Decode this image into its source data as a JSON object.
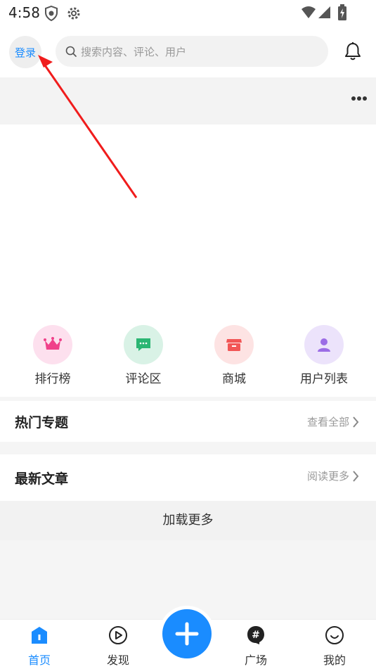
{
  "status_bar": {
    "time": "4:58"
  },
  "header": {
    "login_label": "登录",
    "search_placeholder": "搜索内容、评论、用户"
  },
  "quick_nav": [
    {
      "label": "排行榜",
      "icon": "crown-icon",
      "bg": "#fde0ee",
      "color": "#f0418a"
    },
    {
      "label": "评论区",
      "icon": "comment-icon",
      "bg": "#d9f2e6",
      "color": "#2bb673"
    },
    {
      "label": "商城",
      "icon": "store-icon",
      "bg": "#fde3e3",
      "color": "#f25656"
    },
    {
      "label": "用户列表",
      "icon": "user-icon",
      "bg": "#ece3fb",
      "color": "#9b6ce6"
    }
  ],
  "sections": {
    "hot_topics": {
      "title": "热门专题",
      "more": "查看全部"
    },
    "latest_articles": {
      "title": "最新文章",
      "more": "阅读更多"
    }
  },
  "load_more": "加载更多",
  "tabbar": [
    {
      "label": "首页",
      "icon": "home-icon",
      "active": true
    },
    {
      "label": "发现",
      "icon": "play-icon",
      "active": false
    },
    {
      "label": "广场",
      "icon": "hashtag-icon",
      "active": false
    },
    {
      "label": "我的",
      "icon": "smile-icon",
      "active": false
    }
  ],
  "colors": {
    "accent": "#1a8cff",
    "annotation_arrow": "#f01c1c"
  }
}
